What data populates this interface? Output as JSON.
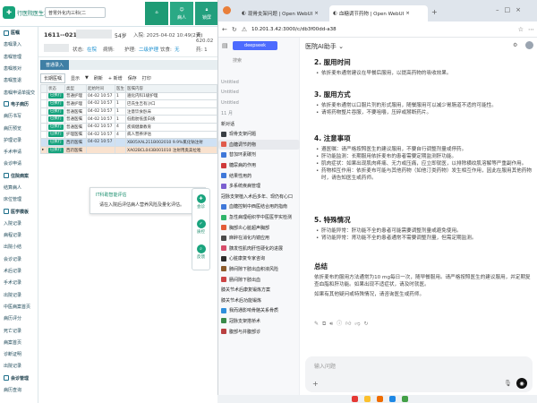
{
  "his": {
    "logo_title": "行医院医生工作站",
    "dept": "普胃外化内三科(二",
    "top_buttons": [
      "",
      "病人",
      "锁屏"
    ],
    "patient": {
      "bed": "1611--021",
      "age": "54岁",
      "status_label": "状态:",
      "status": "在院",
      "admission": "入院: 2025-04-02 10:49(2天)",
      "fee": "费: 620.02",
      "disease_label": "病情:",
      "nurse_label": "护理:",
      "nurse": "二级护理",
      "diet_label": "饮食:",
      "diet": "无",
      "fee2": "药: 1"
    },
    "tab": "普通录入",
    "toolbar": [
      "长期医嘱",
      "显示",
      "▼",
      "刷新",
      "+ 新增",
      "保存",
      "打印"
    ],
    "columns": [
      "",
      "状态",
      "类型",
      "起始时间",
      "医生",
      "医嘱内容"
    ],
    "rows": [
      {
        "status": "已执行",
        "type": "普通护理",
        "time": "04-02 10:57",
        "doc": "1",
        "content": "遍化内科1级护理"
      },
      {
        "status": "已执行",
        "type": "普通护理",
        "time": "04-02 10:57",
        "doc": "1",
        "content": "巴氏生吉有沙口"
      },
      {
        "status": "已执行",
        "type": "普通医嘱",
        "time": "04-02 10:57",
        "doc": "1",
        "content": "注意饮食卧床"
      },
      {
        "status": "已执行",
        "type": "普通医嘱",
        "time": "04-02 10:57",
        "doc": "1",
        "content": "低脂肪低蛋白质"
      },
      {
        "status": "已执行",
        "type": "普通医嘱",
        "time": "04-02 10:57",
        "doc": "4",
        "content": "疾病健康教育"
      },
      {
        "status": "已执行",
        "type": "护理医嘱",
        "time": "04-02 10:57",
        "doc": "4",
        "content": "病人营养评估"
      },
      {
        "status": "已执行",
        "type": "西药医嘱",
        "time": "04-02 10:57",
        "doc": "",
        "content": "XB05XAL211B002010 9.9%氯化钠注射"
      },
      {
        "status": "已执行",
        "type": "西药医嘱",
        "time": "",
        "doc": "",
        "content": "XA02BCL043B001010 注射用奥美拉唑"
      }
    ],
    "side": [
      {
        "g": true,
        "t": "医嘱"
      },
      {
        "t": "患嘱录入"
      },
      {
        "t": "患嘱管理"
      },
      {
        "t": "患嘱核对"
      },
      {
        "t": "患嘱签退"
      },
      {
        "t": "患嘱申请单提交"
      },
      {
        "g": true,
        "t": "电子病历"
      },
      {
        "t": "病历书写"
      },
      {
        "t": "病历预览"
      },
      {
        "t": "护理记录"
      },
      {
        "t": "手术申请"
      },
      {
        "t": "会诊申请"
      },
      {
        "g": true,
        "t": "住院病案"
      },
      {
        "t": "结算病人"
      },
      {
        "t": "床位管理"
      },
      {
        "g": true,
        "t": "医学模板"
      },
      {
        "t": "入院记录"
      },
      {
        "t": "病程记录"
      },
      {
        "t": "出院小结"
      },
      {
        "t": "会诊记录"
      },
      {
        "t": "术后记录"
      },
      {
        "t": "手术记录"
      },
      {
        "t": "出院记录"
      },
      {
        "t": "中医病案首页"
      },
      {
        "t": "病历评分"
      },
      {
        "t": "死亡记录"
      },
      {
        "t": "病案首页"
      },
      {
        "t": "诊断证明"
      },
      {
        "t": "出院记录"
      },
      {
        "g": true,
        "t": "会诊管理"
      },
      {
        "t": "病历查询"
      }
    ],
    "popup": {
      "title": "IT科助智能评估",
      "text": "请在入院后评估病人营养风险及量化评估。",
      "close": "×"
    },
    "float": [
      "会诊",
      "质控",
      "反馈"
    ]
  },
  "browser": {
    "tabs": [
      {
        "t": "现骨支架问题 | Open WebUI",
        "active": false
      },
      {
        "t": "血糖调节药物 | Open WebUI",
        "active": true
      }
    ],
    "new_tab": "+",
    "url": "10.201.3.42:3000/c/db3f00dd-a38",
    "chat_title": "医院AI助手 ⌄",
    "sidebar": {
      "brand": "deepseek",
      "search": "搜索",
      "items": [
        {
          "t": "Untitled",
          "m": true
        },
        {
          "t": "Untitled",
          "m": true
        },
        {
          "t": "Untitled",
          "m": true
        },
        {
          "t": "11 月",
          "m": true
        },
        {
          "t": "新对话",
          "m": false
        },
        {
          "t": "现骨支架问题",
          "m": false,
          "c": "#3a3f44"
        },
        {
          "t": "血糖调节药物",
          "m": false,
          "c": "#e05a4a",
          "sel": true
        },
        {
          "t": "替加环素碳剂",
          "m": false,
          "c": "#3f78d9"
        },
        {
          "t": "糖尿病的作用",
          "m": false,
          "c": "#cf3a3a"
        },
        {
          "t": "结果性用药",
          "m": false,
          "c": "#3f78d9"
        },
        {
          "t": "多系统疾病管理",
          "m": false,
          "c": "#7b5fd0"
        },
        {
          "t": "冠脉支架植入术后多年、现仍有心口",
          "m": false
        },
        {
          "t": "血糖控制中西医结合用药指南",
          "m": false,
          "c": "#3f78d9"
        },
        {
          "t": "急性病理组织学中医医学实检测",
          "m": false,
          "c": "#2fb46a"
        },
        {
          "t": "胸部炎心脏超声胸部",
          "m": false,
          "c": "#e35b38"
        },
        {
          "t": "麻醉在消化内镜应用",
          "m": false,
          "c": "#4a4a4a"
        },
        {
          "t": "胰发性肌肉肝性硬化的进展",
          "m": false,
          "c": "#d64c6a"
        },
        {
          "t": "心脏康复专家咨询",
          "m": false,
          "c": "#2a2a2a"
        },
        {
          "t": "肺间隙下肢出血积液风险",
          "m": false,
          "c": "#8a5a2a"
        },
        {
          "t": "肠间隙下肢出血",
          "m": false,
          "c": "#c44"
        },
        {
          "t": "膝关节术后康复锻炼方案",
          "m": false
        },
        {
          "t": "膝关节术后功能锻炼",
          "m": false
        },
        {
          "t": "我而通影响骨骼关系骨质",
          "m": false,
          "c": "#2f8fdc"
        },
        {
          "t": "冠脉支架搭桥术",
          "m": false,
          "c": "#3a8a4a"
        },
        {
          "t": "腹部与并腹部诊",
          "m": false,
          "c": "#b94040"
        }
      ]
    },
    "content": {
      "s2": "2. 服用时间",
      "s2p": "依折麦布通常建议在早餐后服用，以提高药物的吸收效果。",
      "s3": "3. 服用方式",
      "s3a": "依折麦布通常以口服片剂的形式服用，随餐服用可以减少胃肠道不适的可能性。",
      "s3b": "请将药物整片吞服，不要咀嚼，压碎或掰断药片。",
      "s4": "4. 注意事项",
      "s4a": "遵医嘱：请严格按照医生的建议服用，不要自行调整剂量或停药。",
      "s4b": "肝功能监测：长期服用依折麦布的患者需要定期监测肝功能。",
      "s4c": "肌肉症状：如果出现肌肉疼痛、无力或压痛，应立即就医，以排除横纹肌溶解等严重副作用。",
      "s4d": "药物相互作用：依折麦布可能与其他药物（如他汀类药物）发生相互作用，因此在服用其他药物时，请告知医生或药师。",
      "s5": "5. 特殊情况",
      "s5a": "肝功能异常：肝功能不全的患者可能需要调整剂量或避免使用。",
      "s5b": "肾功能异常：肾功能不全的患者通常不需要调整剂量，但需定期监测。",
      "sum": "总结",
      "sump": "依折麦布的服用方法通常为10 mg每日一次，随早餐服用。请严格按照医生的建议服用，并定期复查血脂和肝功能。如果出现不适症状，请及时就医。",
      "end": "如果有其他疑问或特殊情况，请咨询医生或药师。"
    },
    "input_placeholder": "输入问题"
  }
}
